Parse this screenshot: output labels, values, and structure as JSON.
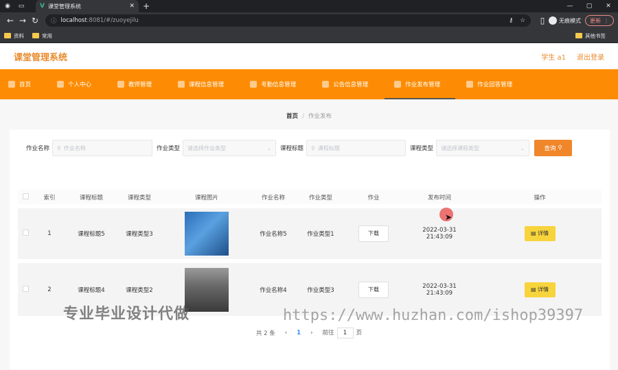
{
  "browser": {
    "tab_title": "课堂管理系统",
    "url_host": "localhost",
    "url_rest": ":8081/#/zuoyejilu",
    "profile_label": "无痕模式",
    "update_label": "更新",
    "bookmarks": [
      "资料",
      "常用"
    ],
    "bookmarks_right": "其他书签"
  },
  "header": {
    "title": "课堂管理系统",
    "user": "学生 a1",
    "logout": "退出登录"
  },
  "nav": [
    {
      "label": "首页"
    },
    {
      "label": "个人中心"
    },
    {
      "label": "教师管理"
    },
    {
      "label": "课程信息管理"
    },
    {
      "label": "考勤信息管理"
    },
    {
      "label": "公告信息管理"
    },
    {
      "label": "作业发布管理"
    },
    {
      "label": "作业回答管理"
    }
  ],
  "breadcrumb": {
    "home": "首页",
    "sep": "/",
    "current": "作业发布"
  },
  "search": {
    "f1_label": "作业名称",
    "f1_placeholder": "作业名称",
    "f2_label": "作业类型",
    "f2_placeholder": "请选择作业类型",
    "f3_label": "课程标题",
    "f3_placeholder": "课程标题",
    "f4_label": "课程类型",
    "f4_placeholder": "请选择课程类型",
    "button": "查询"
  },
  "table": {
    "headers": [
      "索引",
      "课程标题",
      "课程类型",
      "课程图片",
      "作业名称",
      "作业类型",
      "作业",
      "发布时间",
      "操作"
    ],
    "rows": [
      {
        "index": "1",
        "course_title": "课程标题5",
        "course_type": "课程类型3",
        "hw_name": "作业名称5",
        "hw_type": "作业类型1",
        "download": "下载",
        "date": "2022-03-31",
        "time": "21:43:09",
        "action": "详情"
      },
      {
        "index": "2",
        "course_title": "课程标题4",
        "course_type": "课程类型2",
        "hw_name": "作业名称4",
        "hw_type": "作业类型3",
        "download": "下载",
        "date": "2022-03-31",
        "time": "21:43:09",
        "action": "详情"
      }
    ]
  },
  "pager": {
    "total": "共 2 条",
    "prev": "‹",
    "page": "1",
    "next": "›",
    "goto": "前往",
    "goto_value": "1",
    "page_suffix": "页"
  },
  "watermark": {
    "left": "专业毕业设计代做",
    "right": "https://www.huzhan.com/ishop39397"
  },
  "colors": {
    "accent": "#fd8c04",
    "title": "#e88b2d",
    "detail": "#f8d43c"
  }
}
